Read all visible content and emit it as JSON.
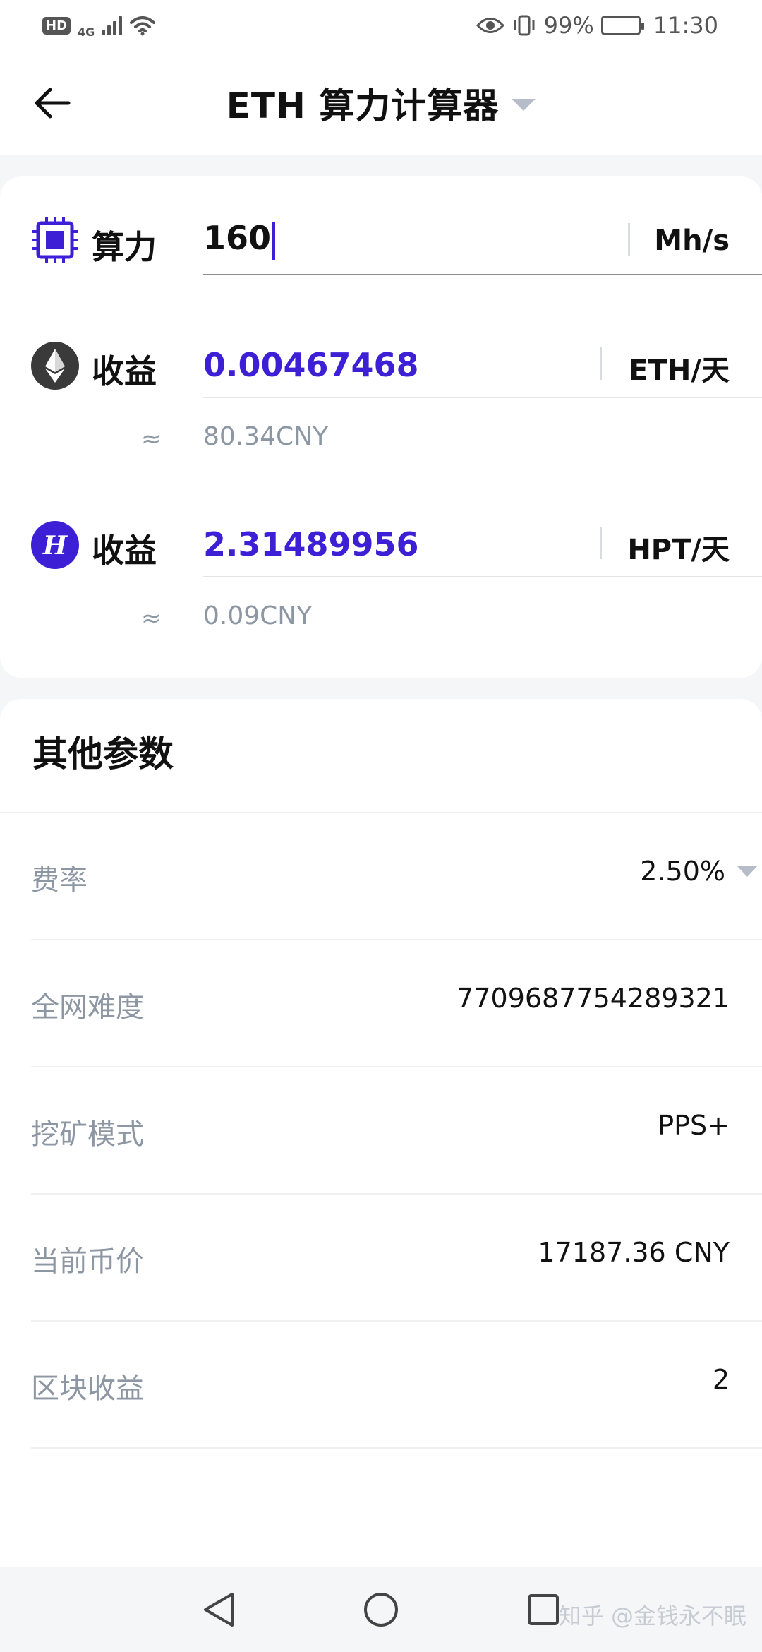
{
  "status_bar": {
    "hd_label": "HD",
    "network": "4G",
    "battery_percent": "99%",
    "time": "11:30"
  },
  "header": {
    "title": "ETH 算力计算器"
  },
  "calculator": {
    "hashrate": {
      "label": "算力",
      "value": "160",
      "unit": "Mh/s",
      "icon": "chip-icon"
    },
    "eth_earnings": {
      "label": "收益",
      "value": "0.00467468",
      "unit": "ETH/天",
      "approx_symbol": "≈",
      "approx_value": "80.34CNY",
      "icon": "ethereum-icon"
    },
    "hpt_earnings": {
      "label": "收益",
      "value": "2.31489956",
      "unit": "HPT/天",
      "approx_symbol": "≈",
      "approx_value": "0.09CNY",
      "icon": "hpt-coin-icon"
    }
  },
  "other_params": {
    "title": "其他参数",
    "rows": [
      {
        "label": "费率",
        "value": "2.50%"
      },
      {
        "label": "全网难度",
        "value": "7709687754289321"
      },
      {
        "label": "挖矿模式",
        "value": "PPS+"
      },
      {
        "label": "当前币价",
        "value": "17187.36 CNY"
      },
      {
        "label": "区块收益",
        "value": "2"
      }
    ]
  },
  "watermark": "知乎 @金钱永不眠",
  "colors": {
    "accent": "#3d1fd6",
    "muted": "#8d97a4",
    "background": "#f5f6f8"
  }
}
